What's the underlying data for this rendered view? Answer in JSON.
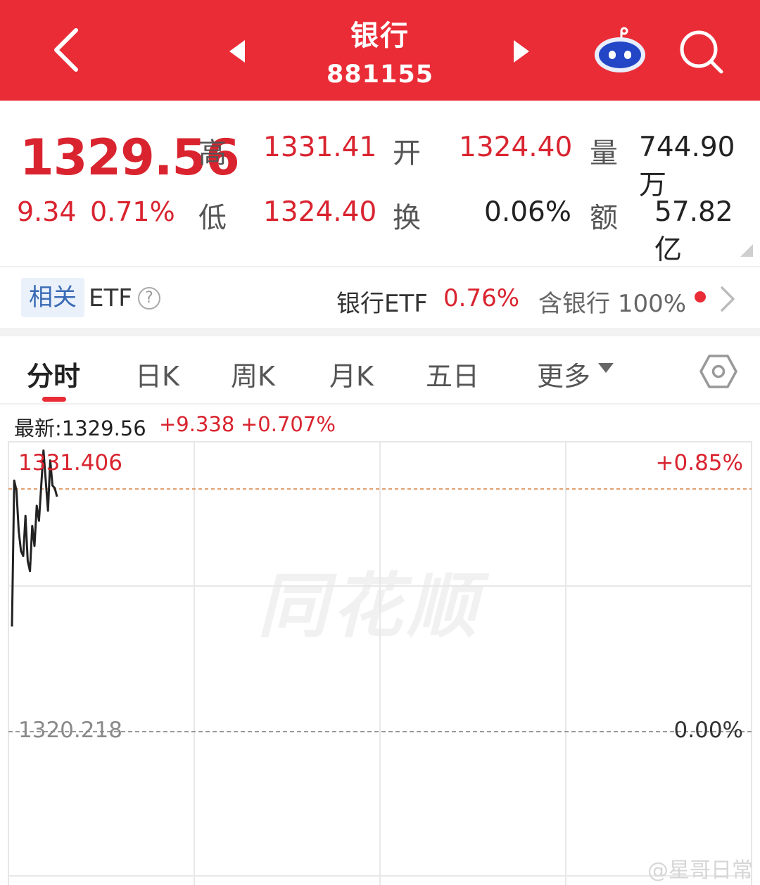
{
  "header": {
    "title": "银行",
    "code": "881155"
  },
  "quote": {
    "price": "1329.56",
    "change": "9.34",
    "change_pct": "0.71%",
    "high_label": "高",
    "high": "1331.41",
    "low_label": "低",
    "low": "1324.40",
    "open_label": "开",
    "open": "1324.40",
    "turnover_label": "换",
    "turnover": "0.06%",
    "volume_label": "量",
    "volume": "744.90万",
    "amount_label": "额",
    "amount": "57.82亿"
  },
  "etf": {
    "tag": "相关",
    "label": "ETF",
    "help": "?",
    "name": "银行ETF",
    "pct": "0.76%",
    "contain_label": "含银行",
    "contain_pct": "100%"
  },
  "tabs": [
    "分时",
    "日K",
    "周K",
    "月K",
    "五日",
    "更多"
  ],
  "latest": {
    "label": "最新:1329.56",
    "change": "+9.338",
    "change_pct": "+0.707%"
  },
  "chart_data": {
    "type": "line",
    "title": "",
    "y_labels": {
      "top_price": "1331.406",
      "top_pct": "+0.85%",
      "base_price": "1320.218",
      "base_pct": "0.00%"
    },
    "ylim": [
      1309.03,
      1331.406
    ],
    "reference": 1320.218,
    "x": [
      0,
      1,
      2,
      3,
      4,
      5,
      6,
      7,
      8,
      9,
      10,
      11,
      12,
      13,
      14,
      15,
      16,
      17,
      18,
      19,
      20
    ],
    "values": [
      1324.4,
      1330.2,
      1329.8,
      1328.2,
      1327.4,
      1327.2,
      1328.8,
      1327.0,
      1326.6,
      1328.4,
      1327.6,
      1329.2,
      1328.6,
      1330.0,
      1331.4,
      1330.2,
      1329.0,
      1331.0,
      1330.0,
      1329.9,
      1329.56
    ],
    "line_color": "#222222",
    "grid": true
  },
  "watermark": "同花顺",
  "footer": {
    "weibo": "@星哥日常"
  }
}
